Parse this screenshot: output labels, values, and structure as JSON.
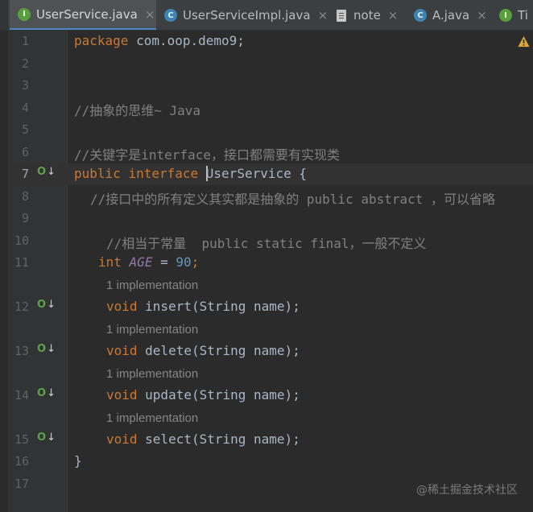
{
  "tabs": [
    {
      "label": "UserService.java",
      "icon": "interface-icon",
      "glyph": "I",
      "active": true,
      "close": "×"
    },
    {
      "label": "UserServiceImpl.java",
      "icon": "class-icon",
      "glyph": "C",
      "active": false,
      "close": "×"
    },
    {
      "label": "note",
      "icon": "text-file-icon",
      "glyph": "",
      "active": false,
      "close": "×"
    },
    {
      "label": "A.java",
      "icon": "class-icon",
      "glyph": "C",
      "active": false,
      "close": "×"
    },
    {
      "label": "Ti",
      "icon": "interface-icon",
      "glyph": "I",
      "active": false,
      "close": ""
    }
  ],
  "gutter": {
    "line_numbers": [
      "1",
      "2",
      "3",
      "4",
      "5",
      "6",
      "7",
      "8",
      "9",
      "10",
      "11",
      "12",
      "13",
      "14",
      "15",
      "16",
      "17"
    ],
    "current_line": "7"
  },
  "code": {
    "l1_kw": "package",
    "l1_rest": " com.oop.demo9;",
    "l4": "//抽象的思维~ Java",
    "l6": "//关键字是interface，接口都需要有实现类",
    "l7_kw1": "public",
    "l7_kw2": "interface",
    "l7_name": "UserService",
    "l7_rest": " {",
    "l8": "//接口中的所有定义其实都是抽象的 public abstract ，可以省略",
    "l10": "//相当于常量  public static final，一般不定义",
    "l11_kw": "int",
    "l11_const": "AGE",
    "l11_eq": " = ",
    "l11_num": "90",
    "l11_semi": ";",
    "l12_kw": "void",
    "l12_rest": " insert(String name);",
    "l13_kw": "void",
    "l13_rest": " delete(String name);",
    "l14_kw": "void",
    "l14_rest": " update(String name);",
    "l15_kw": "void",
    "l15_rest": " select(String name);",
    "l16": "}"
  },
  "hints": {
    "h12": "1 implementation",
    "h13": "1 implementation",
    "h14": "1 implementation",
    "h15": "1 implementation"
  },
  "watermark": "@稀土掘金技术社区",
  "colors": {
    "keyword": "#cc7832",
    "comment": "#808080",
    "number": "#6897bb",
    "constant": "#9876aa",
    "background": "#2b2b2b",
    "tab_accent": "#4a88c7"
  }
}
